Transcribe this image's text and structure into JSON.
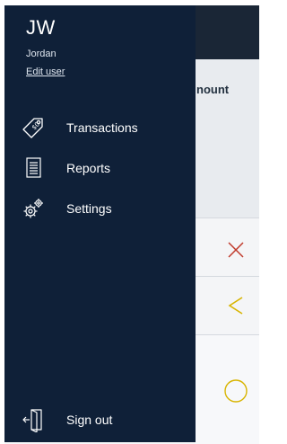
{
  "drawer": {
    "initials": "JW",
    "user_name": "Jordan",
    "edit_user_label": "Edit user",
    "menu": [
      {
        "label": "Transactions",
        "icon": "tag-icon"
      },
      {
        "label": "Reports",
        "icon": "document-icon"
      },
      {
        "label": "Settings",
        "icon": "gears-icon"
      }
    ],
    "sign_out_label": "Sign out"
  },
  "background": {
    "column_header": "nount",
    "rows": [
      {
        "status_icon": "x-icon",
        "color": "#c0392b"
      },
      {
        "status_icon": "chevron-left-icon",
        "color": "#d8b400"
      },
      {
        "status_icon": "circle-icon",
        "color": "#d8b400"
      }
    ]
  },
  "colors": {
    "drawer_bg": "#0f2038",
    "header_bg": "#1a2636"
  }
}
